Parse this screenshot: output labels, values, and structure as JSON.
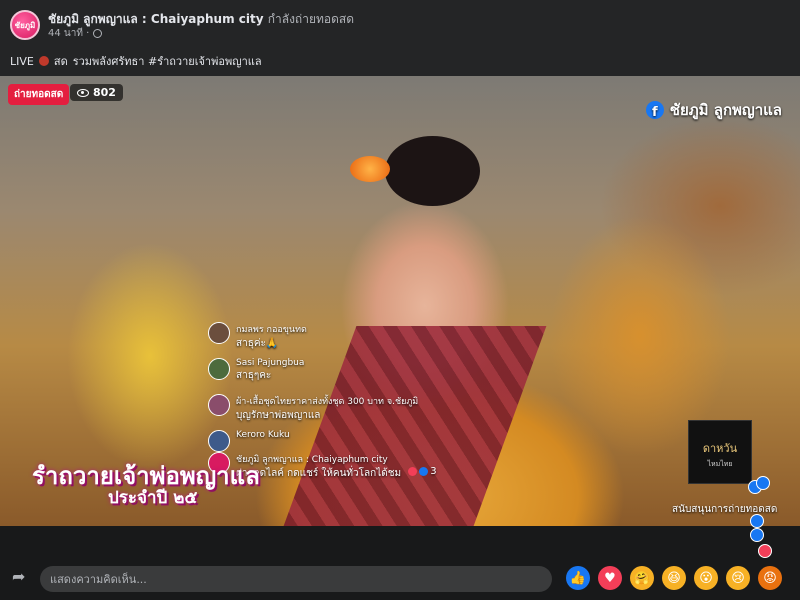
{
  "header": {
    "avatar_text": "ชัยภูมิ",
    "page_name": "ชัยภูมิ ลูกพญาแล : Chaiyaphum city",
    "action": "กำลังถ่ายทอดสด",
    "time": "44 นาที ·",
    "caption_live": "LIVE",
    "caption_state": "สด",
    "caption_text": "รวมพลังศรัทธา #รำถวายเจ้าพ่อพญาแล"
  },
  "video": {
    "live_badge": "ถ่ายทอดสด",
    "viewer_count": "802",
    "watermark": "ชัยภูมิ ลูกพญาแล",
    "overlay_title": "รำถวายเจ้าพ่อพญาแล",
    "overlay_subtitle": "ประจำปี ๒๕",
    "sponsor_logo": "ดาหวัน",
    "sponsor_logo_sub": "ไหมไทย",
    "sponsor_caption": "สนับสนุนการถ่ายทอดสด"
  },
  "comments": [
    {
      "name": "กมลพร กออขุนทด",
      "text": "สาธุค่ะ🙏",
      "avatar_color": "#6b4e3d"
    },
    {
      "name": "Sasi Pajungbua",
      "text": "สาธุๆคะ",
      "avatar_color": "#4d6b3d"
    },
    {
      "name": "ผ้า-เสื้อชุดไทยราคาส่งทั้งชุด 300 บาท จ.ชัยภูมิ",
      "text": "บุญรักษาพ่อพญาแล",
      "avatar_color": "#8a4d6b"
    },
    {
      "name": "Keroro Kuku",
      "text": "",
      "avatar_color": "#3d5a8a"
    },
    {
      "name": "ชัยภูมิ ลูกพญาแล : Chaiyaphum city",
      "text": "ฝากกดไลค์ กดแชร์ ให้คนทั่วโลกได้ชม",
      "reaction_count": "3",
      "avatar_color": "#d81b60"
    }
  ],
  "composer": {
    "placeholder": "แสดงความคิดเห็น...",
    "reactions": [
      {
        "name": "like",
        "color": "#1877f2",
        "glyph": "👍"
      },
      {
        "name": "love",
        "color": "#f33e58",
        "glyph": "♥"
      },
      {
        "name": "care",
        "color": "#f7b125",
        "glyph": "🤗"
      },
      {
        "name": "haha",
        "color": "#f7b125",
        "glyph": "😆"
      },
      {
        "name": "wow",
        "color": "#f7b125",
        "glyph": "😮"
      },
      {
        "name": "sad",
        "color": "#f7b125",
        "glyph": "😢"
      },
      {
        "name": "angry",
        "color": "#e9710f",
        "glyph": "😡"
      }
    ]
  }
}
